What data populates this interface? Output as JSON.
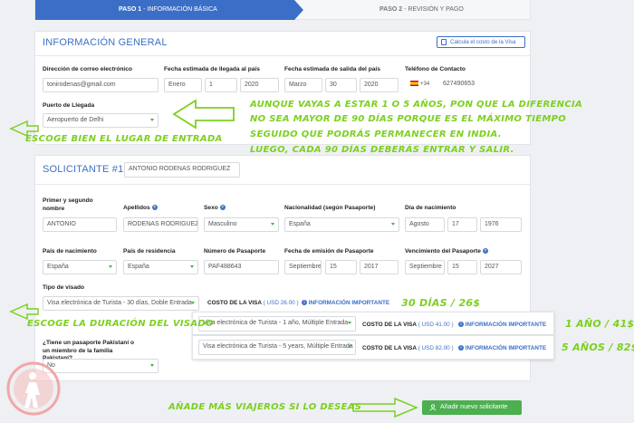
{
  "steps": {
    "step1_num": "PASO 1",
    "step1_sep": " - ",
    "step1_label": "INFORMACIÓN BÁSICA",
    "step2_num": "PASO 2",
    "step2_sep": " - ",
    "step2_label": "REVISIÓN Y PAGO"
  },
  "general": {
    "title": "INFORMACIÓN GENERAL",
    "calc_button": "Calcula el costo de la Visa",
    "email_label": "Dirección de correo electrónico",
    "email_value": "tonirodenas@gmail.com",
    "arrival_label": "Fecha estimada de llegada al país",
    "arrival_month": "Enero",
    "arrival_day": "1",
    "arrival_year": "2020",
    "departure_label": "Fecha estimada de salida del país",
    "departure_month": "Marzo",
    "departure_day": "30",
    "departure_year": "2020",
    "phone_label": "Teléfono de Contacto",
    "phone_code": "+34",
    "phone_value": "627490653",
    "port_label": "Puerto de Llegada",
    "port_value": "Aeropuerto de Delhi"
  },
  "applicant": {
    "title": "SOLICITANTE #1",
    "name_select": "ANTONIO RODENAS RODRIGUEZ",
    "firstname_label": "Primer y segundo nombre",
    "firstname_value": "ANTONIO",
    "lastname_label": "Apellidos",
    "lastname_value": "RODENAS RODRIGUEZ",
    "sex_label": "Sexo",
    "sex_value": "Masculino",
    "nationality_label": "Nacionalidad (según Pasaporte)",
    "nationality_value": "España",
    "birth_label": "Día de nacimiento",
    "birth_month": "Agosto",
    "birth_day": "17",
    "birth_year": "1976",
    "birth_country_label": "País de nacimiento",
    "birth_country_value": "España",
    "residence_label": "País de residencia",
    "residence_value": "España",
    "passport_label": "Número de Pasaporte",
    "passport_value": "PAF488643",
    "issue_label": "Fecha de emisión de Pasaporte",
    "issue_month": "Septiembre",
    "issue_day": "15",
    "issue_year": "2017",
    "expiry_label": "Vencimiento del Pasaporte",
    "expiry_month": "Septiembre",
    "expiry_day": "15",
    "expiry_year": "2027",
    "visa_type_label": "Tipo de visado",
    "visa_type_value": "Visa electrónica de Turista - 30 días, Doble Entrada",
    "cost_label": "COSTO DE LA VISA",
    "cost_value": "( USD 26.00 )",
    "important_label": "INFORMACIÓN IMPORTANTE",
    "pakistani_label": "¿Tiene un pasaporte Pakistaní o un miembro de la familia Pakistaní?",
    "pakistani_value": "No",
    "add_button": "Añadir nuevo solicitante"
  },
  "options": [
    {
      "visa_value": "Visa electrónica de Turista - 1 año, Múltiple Entrada",
      "cost_label": "COSTO DE LA VISA",
      "cost_value": "( USD 41.00 )",
      "important_label": "INFORMACIÓN IMPORTANTE",
      "note": "1 AÑO / 41$"
    },
    {
      "visa_value": "Visa electrónica de Turista - 5 years, Múltiple Entrada",
      "cost_label": "COSTO DE LA VISA",
      "cost_value": "( USD 82.00 )",
      "important_label": "INFORMACIÓN IMPORTANTE",
      "note": "5 AÑOS / 82$"
    }
  ],
  "annotations": {
    "entry_point": "ESCOGE BIEN EL LUGAR DE ENTRADA",
    "stay_line1": "AUNQUE VAYAS A ESTAR 1 O 5 AÑOS, PON QUE LA DIFERENCIA",
    "stay_line2": "NO SEA MAYOR DE 90 DÍAS PORQUE ES EL MÁXIMO TIEMPO",
    "stay_line3": "SEGUIDO QUE PODRÁS PERMANECER EN INDIA.",
    "stay_line4": "LUEGO, CADA 90 DÍAS DEBERÁS ENTRAR Y SALIR.",
    "visa_duration": "ESCOGE LA DURACIÓN DEL VISADO",
    "thirty_days": "30 DÍAS / 26$",
    "add_travelers": "AÑADE MÁS VIAJEROS SI LO DESEAS"
  },
  "colors": {
    "accent": "#3b6fc7",
    "green": "#4caf50",
    "annotation": "#7cd01f"
  }
}
